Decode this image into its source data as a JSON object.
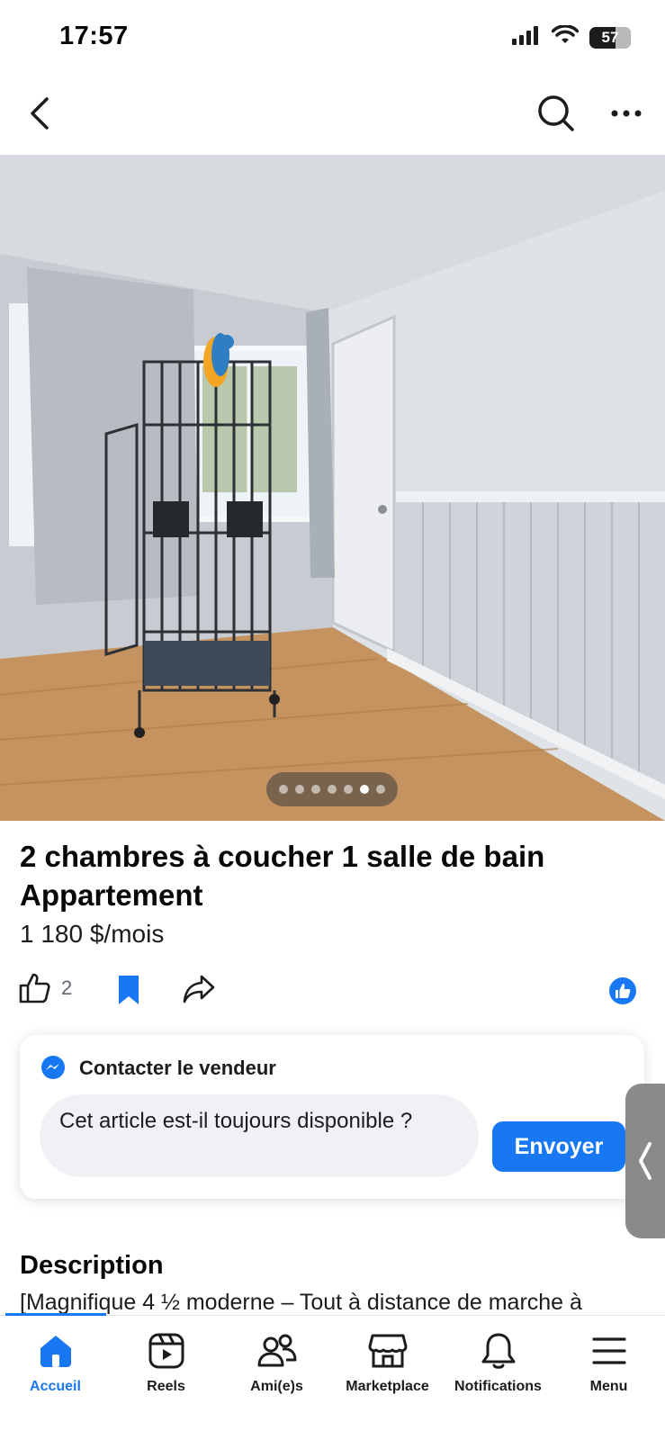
{
  "status_bar": {
    "time": "17:57",
    "battery": "57",
    "icons": [
      "signal-icon",
      "wifi-icon",
      "battery-icon"
    ]
  },
  "nav": {
    "icons": [
      "back-chevron-icon",
      "search-icon",
      "more-horizontal-icon"
    ]
  },
  "photo": {
    "page_count": 7,
    "active_page": 6
  },
  "listing": {
    "title": "2 chambres à coucher 1 salle de bain Appartement",
    "price": "1 180 $/mois",
    "like_count": "2"
  },
  "contact": {
    "title": "Contacter le vendeur",
    "message": "Cet article est-il toujours disponible ?",
    "send_label": "Envoyer"
  },
  "description": {
    "heading": "Description",
    "text": "[Magnifique 4 ½ moderne – Tout à distance de marche à"
  },
  "tab_bar": {
    "tabs": [
      {
        "label": "Accueil",
        "icon": "home-icon",
        "active": true
      },
      {
        "label": "Reels",
        "icon": "reels-icon",
        "active": false
      },
      {
        "label": "Ami(e)s",
        "icon": "friends-icon",
        "active": false
      },
      {
        "label": "Marketplace",
        "icon": "marketplace-icon",
        "active": false
      },
      {
        "label": "Notifications",
        "icon": "bell-icon",
        "active": false
      },
      {
        "label": "Menu",
        "icon": "menu-icon",
        "active": false
      }
    ]
  },
  "colors": {
    "accent": "#1877f2",
    "text": "#080809",
    "secondary_text": "#606770"
  }
}
